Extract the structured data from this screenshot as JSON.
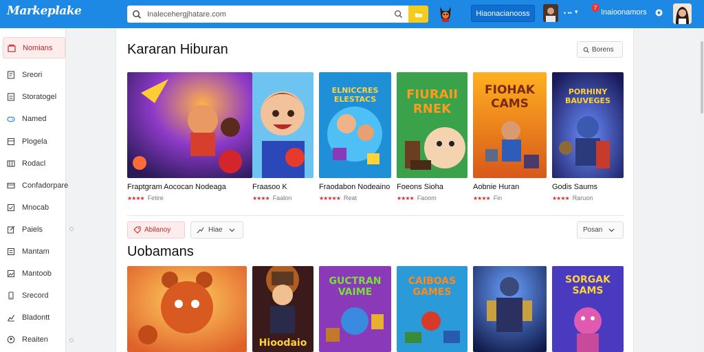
{
  "app": {
    "logo_text": "Markeplake"
  },
  "search": {
    "value": "Inalecehergjhatare.com",
    "placeholder": ""
  },
  "topbar": {
    "store_button_label": "Hiaonacianooss",
    "user_dots": "• ••",
    "user_chevron": "▾",
    "notification_count": "7",
    "account_name": "Inaioonamors",
    "accent_color": "#1e88e5",
    "folder_button_color": "#f5cc1b"
  },
  "sidebar": {
    "items": [
      {
        "label": "Nomians",
        "icon": "shop-icon",
        "active": true
      },
      {
        "label": "Sreori",
        "icon": "receipt-icon"
      },
      {
        "label": "Storatogel",
        "icon": "doc-icon"
      },
      {
        "label": "Named",
        "icon": "gamepad-icon"
      },
      {
        "label": "Plogela",
        "icon": "grid-icon"
      },
      {
        "label": "Rodacl",
        "icon": "table-icon"
      },
      {
        "label": "Confadorpare",
        "icon": "card-icon"
      },
      {
        "label": "Mnocab",
        "icon": "check-icon"
      },
      {
        "label": "Paiels",
        "icon": "edit-icon"
      },
      {
        "label": "Mantam",
        "icon": "list-icon"
      },
      {
        "label": "Mantoob",
        "icon": "image-icon"
      },
      {
        "label": "Srecord",
        "icon": "phone-icon"
      },
      {
        "label": "Bladontt",
        "icon": "chart-icon"
      },
      {
        "label": "Reaiten",
        "icon": "user-icon"
      }
    ]
  },
  "section1": {
    "title": "Kararan Hiburan",
    "sort_label": "Borens",
    "cards": [
      {
        "title": "Fraptgram Aococan Nodeaga",
        "meta": "Fetire",
        "thumb": "game-thumb-hero",
        "caption": ""
      },
      {
        "title": "Fraasoo K",
        "meta": "Faalon",
        "thumb": "game-thumb-boy",
        "caption": ""
      },
      {
        "title": "Fraodabon Nodeaino",
        "meta": "Reat",
        "thumb": "game-thumb-puzzle",
        "caption": "ELNICCRES ELESTACS"
      },
      {
        "title": "Foeons Sioha",
        "meta": "Faoom",
        "thumb": "game-thumb-frog",
        "caption": "FIURAII RNEK"
      },
      {
        "title": "Aobnie Huran",
        "meta": "Fin",
        "thumb": "game-thumb-adventure",
        "caption": "FIOHAK CAMS"
      },
      {
        "title": "Godis Saums",
        "meta": "Raruon",
        "thumb": "game-thumb-knight",
        "caption": "PORHINY BAUVEGES"
      }
    ]
  },
  "filters": {
    "filter1_label": "Abilanoy",
    "filter2_label": "Hiae",
    "sort_label": "Posan"
  },
  "section2": {
    "title": "Uobamans",
    "cards": [
      {
        "thumb": "game-thumb-bear",
        "caption": ""
      },
      {
        "thumb": "game-thumb-hat",
        "caption": "Hioodaio"
      },
      {
        "thumb": "game-thumb-blue",
        "caption": "GUCTRAN VAIME"
      },
      {
        "thumb": "game-thumb-cars",
        "caption": "CAIBOAS GAMES"
      },
      {
        "thumb": "game-thumb-robot",
        "caption": ""
      },
      {
        "thumb": "game-thumb-pink",
        "caption": "SORGAK SAMS"
      }
    ]
  }
}
